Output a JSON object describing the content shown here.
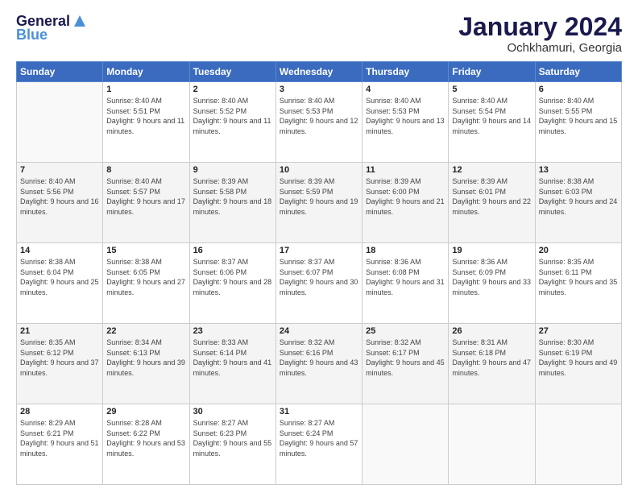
{
  "header": {
    "logo_line1": "General",
    "logo_line2": "Blue",
    "title": "January 2024",
    "subtitle": "Ochkhamuri, Georgia"
  },
  "weekdays": [
    "Sunday",
    "Monday",
    "Tuesday",
    "Wednesday",
    "Thursday",
    "Friday",
    "Saturday"
  ],
  "weeks": [
    [
      {
        "day": "",
        "sunrise": "",
        "sunset": "",
        "daylight": ""
      },
      {
        "day": "1",
        "sunrise": "Sunrise: 8:40 AM",
        "sunset": "Sunset: 5:51 PM",
        "daylight": "Daylight: 9 hours and 11 minutes."
      },
      {
        "day": "2",
        "sunrise": "Sunrise: 8:40 AM",
        "sunset": "Sunset: 5:52 PM",
        "daylight": "Daylight: 9 hours and 11 minutes."
      },
      {
        "day": "3",
        "sunrise": "Sunrise: 8:40 AM",
        "sunset": "Sunset: 5:53 PM",
        "daylight": "Daylight: 9 hours and 12 minutes."
      },
      {
        "day": "4",
        "sunrise": "Sunrise: 8:40 AM",
        "sunset": "Sunset: 5:53 PM",
        "daylight": "Daylight: 9 hours and 13 minutes."
      },
      {
        "day": "5",
        "sunrise": "Sunrise: 8:40 AM",
        "sunset": "Sunset: 5:54 PM",
        "daylight": "Daylight: 9 hours and 14 minutes."
      },
      {
        "day": "6",
        "sunrise": "Sunrise: 8:40 AM",
        "sunset": "Sunset: 5:55 PM",
        "daylight": "Daylight: 9 hours and 15 minutes."
      }
    ],
    [
      {
        "day": "7",
        "sunrise": "Sunrise: 8:40 AM",
        "sunset": "Sunset: 5:56 PM",
        "daylight": "Daylight: 9 hours and 16 minutes."
      },
      {
        "day": "8",
        "sunrise": "Sunrise: 8:40 AM",
        "sunset": "Sunset: 5:57 PM",
        "daylight": "Daylight: 9 hours and 17 minutes."
      },
      {
        "day": "9",
        "sunrise": "Sunrise: 8:39 AM",
        "sunset": "Sunset: 5:58 PM",
        "daylight": "Daylight: 9 hours and 18 minutes."
      },
      {
        "day": "10",
        "sunrise": "Sunrise: 8:39 AM",
        "sunset": "Sunset: 5:59 PM",
        "daylight": "Daylight: 9 hours and 19 minutes."
      },
      {
        "day": "11",
        "sunrise": "Sunrise: 8:39 AM",
        "sunset": "Sunset: 6:00 PM",
        "daylight": "Daylight: 9 hours and 21 minutes."
      },
      {
        "day": "12",
        "sunrise": "Sunrise: 8:39 AM",
        "sunset": "Sunset: 6:01 PM",
        "daylight": "Daylight: 9 hours and 22 minutes."
      },
      {
        "day": "13",
        "sunrise": "Sunrise: 8:38 AM",
        "sunset": "Sunset: 6:03 PM",
        "daylight": "Daylight: 9 hours and 24 minutes."
      }
    ],
    [
      {
        "day": "14",
        "sunrise": "Sunrise: 8:38 AM",
        "sunset": "Sunset: 6:04 PM",
        "daylight": "Daylight: 9 hours and 25 minutes."
      },
      {
        "day": "15",
        "sunrise": "Sunrise: 8:38 AM",
        "sunset": "Sunset: 6:05 PM",
        "daylight": "Daylight: 9 hours and 27 minutes."
      },
      {
        "day": "16",
        "sunrise": "Sunrise: 8:37 AM",
        "sunset": "Sunset: 6:06 PM",
        "daylight": "Daylight: 9 hours and 28 minutes."
      },
      {
        "day": "17",
        "sunrise": "Sunrise: 8:37 AM",
        "sunset": "Sunset: 6:07 PM",
        "daylight": "Daylight: 9 hours and 30 minutes."
      },
      {
        "day": "18",
        "sunrise": "Sunrise: 8:36 AM",
        "sunset": "Sunset: 6:08 PM",
        "daylight": "Daylight: 9 hours and 31 minutes."
      },
      {
        "day": "19",
        "sunrise": "Sunrise: 8:36 AM",
        "sunset": "Sunset: 6:09 PM",
        "daylight": "Daylight: 9 hours and 33 minutes."
      },
      {
        "day": "20",
        "sunrise": "Sunrise: 8:35 AM",
        "sunset": "Sunset: 6:11 PM",
        "daylight": "Daylight: 9 hours and 35 minutes."
      }
    ],
    [
      {
        "day": "21",
        "sunrise": "Sunrise: 8:35 AM",
        "sunset": "Sunset: 6:12 PM",
        "daylight": "Daylight: 9 hours and 37 minutes."
      },
      {
        "day": "22",
        "sunrise": "Sunrise: 8:34 AM",
        "sunset": "Sunset: 6:13 PM",
        "daylight": "Daylight: 9 hours and 39 minutes."
      },
      {
        "day": "23",
        "sunrise": "Sunrise: 8:33 AM",
        "sunset": "Sunset: 6:14 PM",
        "daylight": "Daylight: 9 hours and 41 minutes."
      },
      {
        "day": "24",
        "sunrise": "Sunrise: 8:32 AM",
        "sunset": "Sunset: 6:16 PM",
        "daylight": "Daylight: 9 hours and 43 minutes."
      },
      {
        "day": "25",
        "sunrise": "Sunrise: 8:32 AM",
        "sunset": "Sunset: 6:17 PM",
        "daylight": "Daylight: 9 hours and 45 minutes."
      },
      {
        "day": "26",
        "sunrise": "Sunrise: 8:31 AM",
        "sunset": "Sunset: 6:18 PM",
        "daylight": "Daylight: 9 hours and 47 minutes."
      },
      {
        "day": "27",
        "sunrise": "Sunrise: 8:30 AM",
        "sunset": "Sunset: 6:19 PM",
        "daylight": "Daylight: 9 hours and 49 minutes."
      }
    ],
    [
      {
        "day": "28",
        "sunrise": "Sunrise: 8:29 AM",
        "sunset": "Sunset: 6:21 PM",
        "daylight": "Daylight: 9 hours and 51 minutes."
      },
      {
        "day": "29",
        "sunrise": "Sunrise: 8:28 AM",
        "sunset": "Sunset: 6:22 PM",
        "daylight": "Daylight: 9 hours and 53 minutes."
      },
      {
        "day": "30",
        "sunrise": "Sunrise: 8:27 AM",
        "sunset": "Sunset: 6:23 PM",
        "daylight": "Daylight: 9 hours and 55 minutes."
      },
      {
        "day": "31",
        "sunrise": "Sunrise: 8:27 AM",
        "sunset": "Sunset: 6:24 PM",
        "daylight": "Daylight: 9 hours and 57 minutes."
      },
      {
        "day": "",
        "sunrise": "",
        "sunset": "",
        "daylight": ""
      },
      {
        "day": "",
        "sunrise": "",
        "sunset": "",
        "daylight": ""
      },
      {
        "day": "",
        "sunrise": "",
        "sunset": "",
        "daylight": ""
      }
    ]
  ],
  "colors": {
    "header_bg": "#3a6bbf",
    "row_shade": "#f4f4f4",
    "empty_bg": "#f9f9f9"
  }
}
